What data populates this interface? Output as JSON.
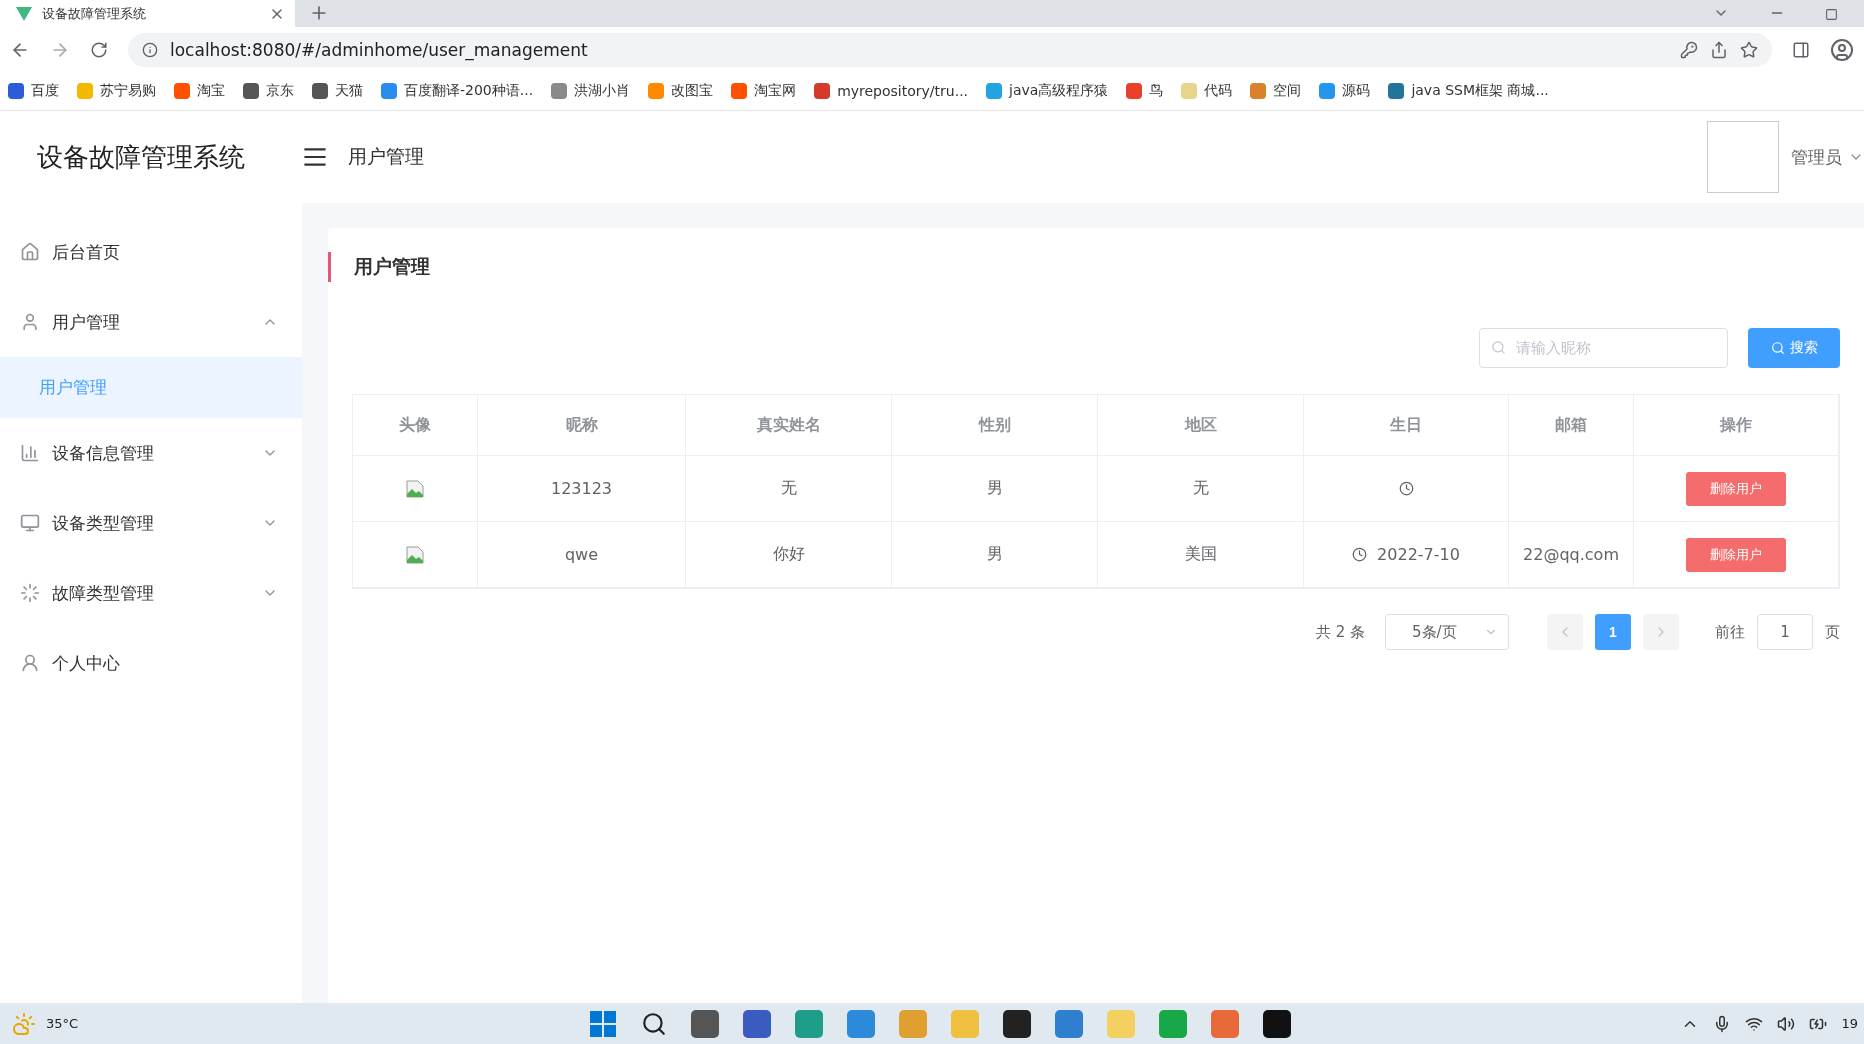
{
  "browser": {
    "tab_title": "设备故障管理系统",
    "url": "localhost:8080/#/adminhome/user_management",
    "bookmarks": [
      {
        "label": "百度",
        "color": "#2b5cd9"
      },
      {
        "label": "苏宁易购",
        "color": "#f5b800"
      },
      {
        "label": "淘宝",
        "color": "#ff5000"
      },
      {
        "label": "京东",
        "color": "#555555"
      },
      {
        "label": "天猫",
        "color": "#555555"
      },
      {
        "label": "百度翻译-200种语...",
        "color": "#2b8cf0"
      },
      {
        "label": "洪湖小肖",
        "color": "#8a8a8a"
      },
      {
        "label": "改图宝",
        "color": "#ff8a00"
      },
      {
        "label": "淘宝网",
        "color": "#ff5000"
      },
      {
        "label": "myrepository/tru...",
        "color": "#d33a2c"
      },
      {
        "label": "java高级程序猿",
        "color": "#21a4e0"
      },
      {
        "label": "鸟",
        "color": "#e8402a"
      },
      {
        "label": "代码",
        "color": "#e8d48a"
      },
      {
        "label": "空间",
        "color": "#d9822b"
      },
      {
        "label": "源码",
        "color": "#2496ed"
      },
      {
        "label": "java SSM框架 商城...",
        "color": "#21759b"
      }
    ]
  },
  "header": {
    "logo": "设备故障管理系统",
    "breadcrumb": "用户管理",
    "user": "管理员"
  },
  "sidebar": {
    "items": [
      {
        "kind": "link",
        "label": "后台首页"
      },
      {
        "kind": "group",
        "label": "用户管理",
        "expanded": true,
        "children": [
          {
            "label": "用户管理",
            "selected": true
          }
        ]
      },
      {
        "kind": "group",
        "label": "设备信息管理",
        "expanded": false
      },
      {
        "kind": "group",
        "label": "设备类型管理",
        "expanded": false
      },
      {
        "kind": "group",
        "label": "故障类型管理",
        "expanded": false
      },
      {
        "kind": "link",
        "label": "个人中心"
      }
    ]
  },
  "page": {
    "title": "用户管理",
    "search": {
      "placeholder": "请输入昵称"
    },
    "search_button": "搜索",
    "table": {
      "columns": [
        "头像",
        "昵称",
        "真实姓名",
        "性别",
        "地区",
        "生日",
        "邮箱",
        "操作"
      ],
      "rows": [
        {
          "nickname": "123123",
          "real_name": "无",
          "gender": "男",
          "region": "无",
          "action": "删除用户"
        },
        {
          "nickname": "qwe",
          "real_name": "你好",
          "gender": "男",
          "region": "美国",
          "birthday": "2022-7-10",
          "email": "22@qq.com",
          "action": "删除用户"
        }
      ]
    },
    "pagination": {
      "total": "共 2 条",
      "page_size": "5条/页",
      "pages": [
        {
          "label": "1",
          "selected": true
        }
      ],
      "goto_label": "前往",
      "goto_value": "1",
      "page_suffix": "页"
    }
  },
  "taskbar": {
    "temperature": "35°C",
    "clock": "19"
  }
}
